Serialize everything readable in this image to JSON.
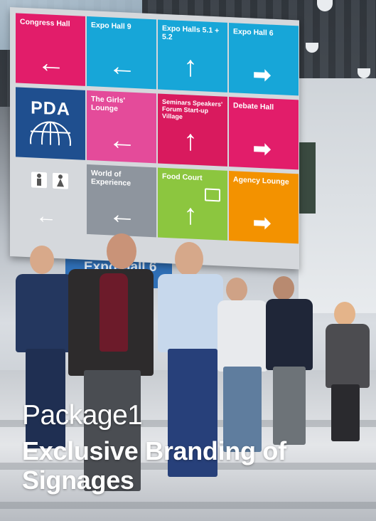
{
  "sign": {
    "tiles": [
      {
        "label": "Congress Hall",
        "color": "#e21d6a",
        "arrow": "left"
      },
      {
        "label": "Expo Hall 9",
        "color": "#17a6d8",
        "arrow": "left"
      },
      {
        "label": "Expo Halls 5.1 + 5.2",
        "color": "#17a6d8",
        "arrow": "up"
      },
      {
        "label": "Expo Hall 6",
        "color": "#17a6d8",
        "arrow": "right"
      },
      {
        "label": "",
        "color": "#1f4f8f",
        "arrow": "none"
      },
      {
        "label": "The Girls' Lounge",
        "color": "#e44b9a",
        "arrow": "left"
      },
      {
        "label": "Seminars Speakers' Forum Start-up Village",
        "color": "#d91a5e",
        "arrow": "up"
      },
      {
        "label": "Debate Hall",
        "color": "#e21d6a",
        "arrow": "right"
      },
      {
        "label": "",
        "color": "#d5d8dc",
        "arrow": "left"
      },
      {
        "label": "World of Experience",
        "color": "#8e959e",
        "arrow": "left"
      },
      {
        "label": "Food Court",
        "color": "#8cc63f",
        "arrow": "up"
      },
      {
        "label": "Agency Lounge",
        "color": "#f39200",
        "arrow": "right"
      }
    ],
    "logo_text": "PDA",
    "logo_icon": "globe-icon",
    "restroom_icons": [
      "male-restroom-icon",
      "female-restroom-icon"
    ]
  },
  "background_banner": "Expo Hall 6",
  "caption": {
    "package": "Package1",
    "title": "Exclusive Branding of Signages"
  }
}
